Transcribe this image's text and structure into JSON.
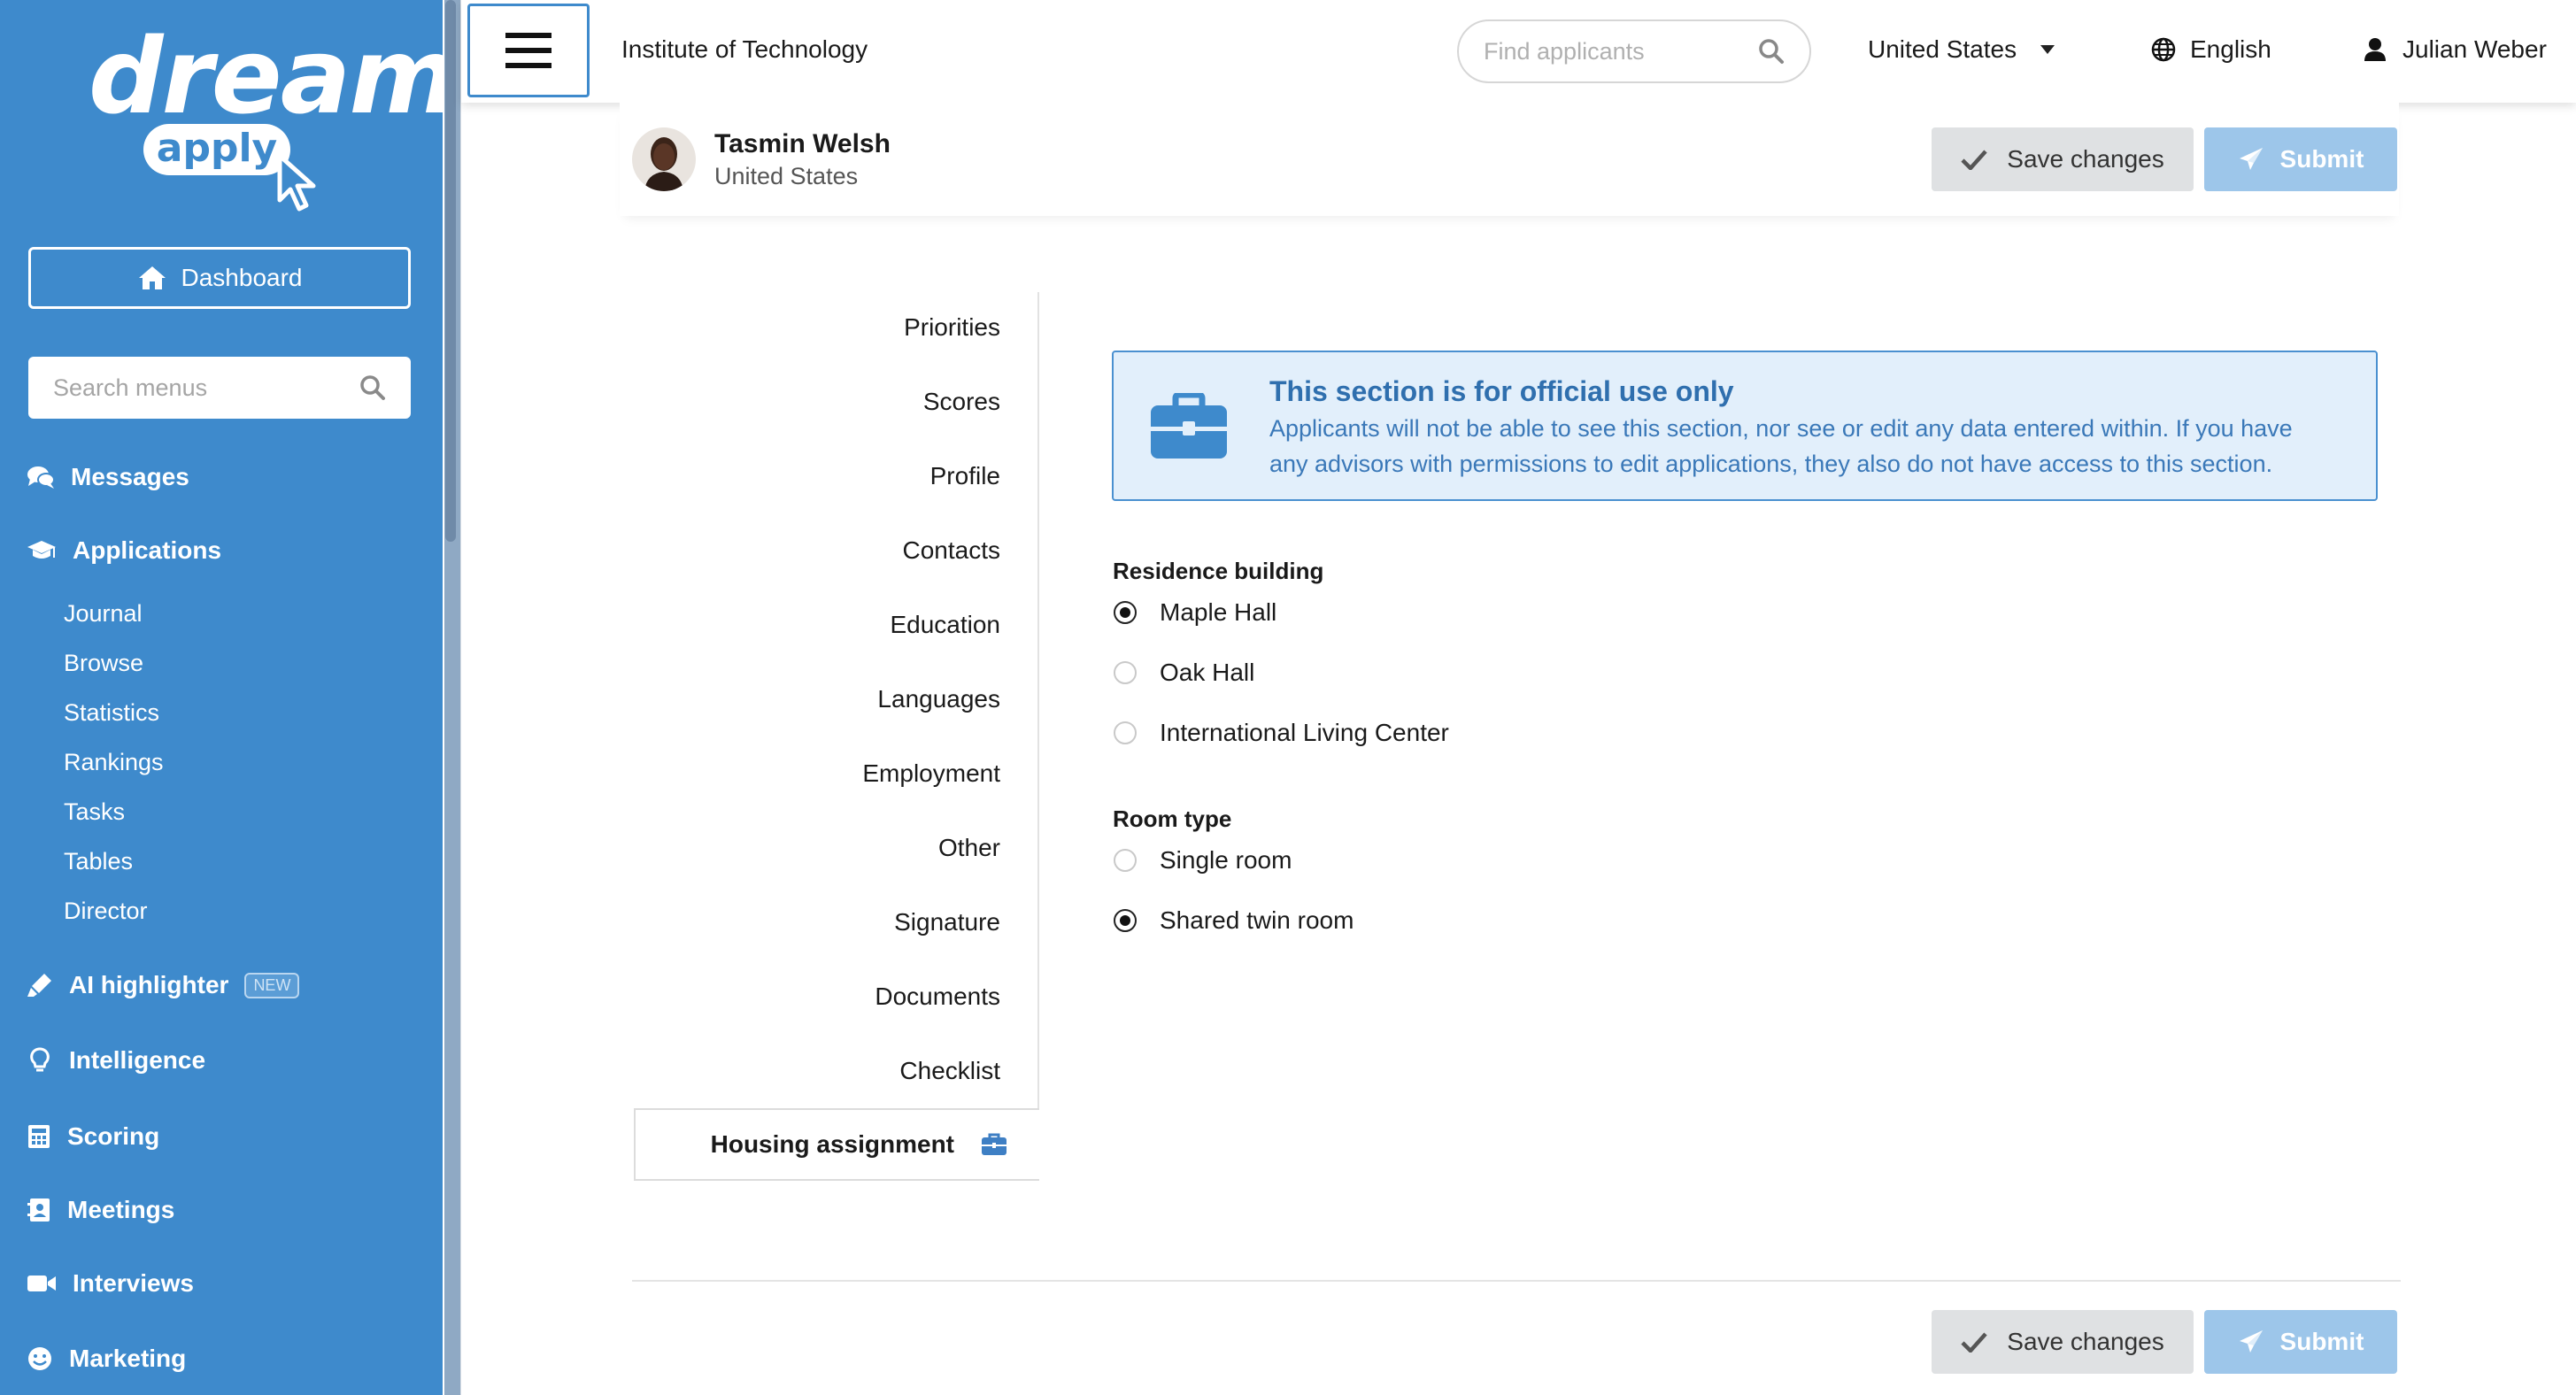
{
  "sidebar": {
    "logo": {
      "word": "dream",
      "pill": "apply"
    },
    "dashboard_label": "Dashboard",
    "search_placeholder": "Search menus",
    "nav": [
      {
        "label": "Messages",
        "icon": "comments-icon"
      },
      {
        "label": "Applications",
        "icon": "graduation-cap-icon"
      },
      {
        "label": "AI highlighter",
        "icon": "highlighter-icon",
        "badge": "NEW"
      },
      {
        "label": "Intelligence",
        "icon": "lightbulb-icon"
      },
      {
        "label": "Scoring",
        "icon": "calculator-icon"
      },
      {
        "label": "Meetings",
        "icon": "address-book-icon"
      },
      {
        "label": "Interviews",
        "icon": "video-icon"
      },
      {
        "label": "Marketing",
        "icon": "smile-icon"
      }
    ],
    "applications_sub": [
      "Journal",
      "Browse",
      "Statistics",
      "Rankings",
      "Tasks",
      "Tables",
      "Director"
    ]
  },
  "topbar": {
    "institution": "Institute of Technology",
    "find_placeholder": "Find applicants",
    "country": "United States",
    "language": "English",
    "user": "Julian Weber"
  },
  "applicant": {
    "name": "Tasmin Welsh",
    "country": "United States"
  },
  "actions": {
    "save_label": "Save changes",
    "submit_label": "Submit"
  },
  "sections": {
    "items": [
      "Priorities",
      "Scores",
      "Profile",
      "Contacts",
      "Education",
      "Languages",
      "Employment",
      "Other",
      "Signature",
      "Documents",
      "Checklist"
    ],
    "active": "Housing assignment"
  },
  "notice": {
    "title": "This section is for official use only",
    "body": "Applicants will not be able to see this section, nor see or edit any data entered within. If you have any advisors with permissions to edit applications, they also do not have access to this section."
  },
  "form": {
    "residence": {
      "label": "Residence building",
      "options": [
        {
          "label": "Maple Hall",
          "selected": true
        },
        {
          "label": "Oak Hall",
          "selected": false
        },
        {
          "label": "International Living Center",
          "selected": false
        }
      ]
    },
    "room": {
      "label": "Room type",
      "options": [
        {
          "label": "Single room",
          "selected": false
        },
        {
          "label": "Shared twin room",
          "selected": true
        }
      ]
    }
  },
  "colors": {
    "sidebar_bg": "#3e8acc",
    "accent": "#4a90d0",
    "notice_bg": "#e2effb",
    "submit_bg": "#9dc6ea",
    "save_bg": "#dfe1e3"
  }
}
